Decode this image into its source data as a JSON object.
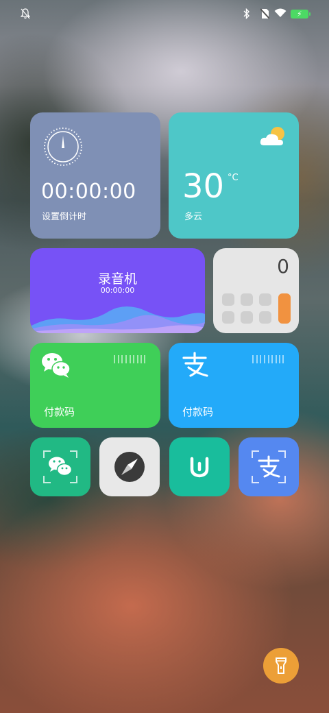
{
  "status_bar": {
    "icons": [
      "bell-muted-icon",
      "bluetooth-icon",
      "no-sim-icon",
      "wifi-icon",
      "battery-charging-icon"
    ],
    "battery_color": "#4cd964"
  },
  "widgets": {
    "timer": {
      "time": "00:00:00",
      "label": "设置倒计时",
      "color": "#7f90b5"
    },
    "weather": {
      "temperature": "30",
      "unit": "°C",
      "condition": "多云",
      "color": "#4ec7c8",
      "icon": "partly-cloudy-icon"
    },
    "recorder": {
      "title": "录音机",
      "time": "00:00:00",
      "color": "#7752f6"
    },
    "calculator": {
      "display": "0",
      "accent": "#f19240"
    },
    "wechat_pay": {
      "label": "付款码",
      "color": "#3fcf58",
      "icon": "wechat-icon"
    },
    "alipay_pay": {
      "label": "付款码",
      "color": "#23aaf9",
      "icon": "alipay-icon"
    }
  },
  "apps": [
    {
      "icon": "wechat-scan-icon",
      "color": "#21b984"
    },
    {
      "icon": "compass-icon",
      "color": "#e8e8e8"
    },
    {
      "icon": "mi-home-icon",
      "color": "#19bd9c"
    },
    {
      "icon": "alipay-scan-icon",
      "color": "#5588f0"
    }
  ],
  "flashlight": {
    "icon": "flashlight-icon",
    "color": "#ec9f37"
  }
}
